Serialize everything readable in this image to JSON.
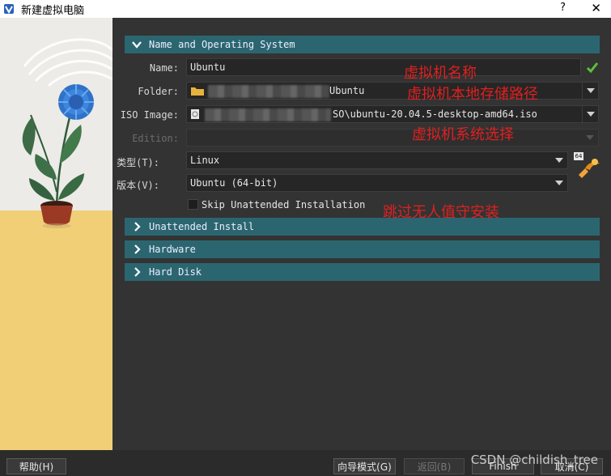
{
  "window": {
    "title": "新建虚拟电脑",
    "help_glyph": "?",
    "close_glyph": "✕"
  },
  "sections": {
    "name_os": {
      "label": "Name and Operating System"
    },
    "unattended": {
      "label": "Unattended Install"
    },
    "hardware": {
      "label": "Hardware"
    },
    "hard_disk": {
      "label": "Hard Disk"
    }
  },
  "form": {
    "name": {
      "label": "Name:",
      "value": "Ubuntu"
    },
    "folder": {
      "label": "Folder:",
      "value_suffix": "Ubuntu"
    },
    "iso": {
      "label": "ISO Image:",
      "value_suffix": "SO\\ubuntu-20.04.5-desktop-amd64.iso"
    },
    "edition": {
      "label": "Edition:",
      "value": ""
    },
    "type": {
      "label": "类型(T):",
      "value": "Linux"
    },
    "version": {
      "label": "版本(V):",
      "value": "Ubuntu (64-bit)"
    },
    "skip_unattended": {
      "label": "Skip Unattended Installation",
      "checked": false
    },
    "os_badge": "64"
  },
  "annotations": {
    "name": "虚拟机名称",
    "folder": "虚拟机本地存储路径",
    "os": "虚拟机系统选择",
    "skip": "跳过无人值守安装"
  },
  "buttons": {
    "help": "帮助(H)",
    "guided": "向导模式(G)",
    "back": "返回(B)",
    "finish": "Finish",
    "cancel": "取消(C)"
  },
  "watermark": "CSDN @childish_tree",
  "colors": {
    "section_header": "#2b6670",
    "annotation": "#e02020",
    "check": "#5fbf3a"
  }
}
